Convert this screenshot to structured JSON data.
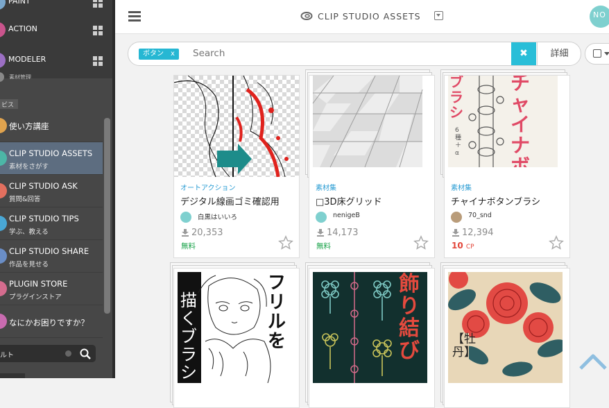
{
  "sidebar": {
    "apps": [
      {
        "label": "PAINT",
        "color": "#7aa7cc"
      },
      {
        "label": "ACTION",
        "color": "#c9548c"
      },
      {
        "label": "MODELER",
        "color": "#9b6fc3"
      }
    ],
    "partial_text": "素材管理",
    "section_label": "ビス",
    "nav": [
      {
        "title": "使い方講座",
        "subtitle": "",
        "color": "#e0a34e"
      },
      {
        "title": "CLIP STUDIO ASSETS",
        "subtitle": "素材をさがす",
        "color": "#4cb6a7",
        "active": true
      },
      {
        "title": "CLIP STUDIO ASK",
        "subtitle": "質問&回答",
        "color": "#e36f5e"
      },
      {
        "title": "CLIP STUDIO TIPS",
        "subtitle": "学ぶ、教える",
        "color": "#49a7d5"
      },
      {
        "title": "CLIP STUDIO SHARE",
        "subtitle": "作品を見せる",
        "color": "#6a8ec7"
      },
      {
        "title": "PLUGIN STORE",
        "subtitle": "プラグインストア",
        "color": "#d46c8e"
      },
      {
        "title": "なにかお困りですか？",
        "subtitle": "",
        "color": "#c96bb0"
      }
    ],
    "search_value": "ルト"
  },
  "header": {
    "brand": "CLIP STUDIO ASSETS",
    "avatar_text": "NO"
  },
  "search": {
    "tag": "ボタン",
    "tag_remove": "x",
    "placeholder": "Search",
    "clear": "✖",
    "detail": "詳細"
  },
  "cards": [
    {
      "category": "オートアクション",
      "title": "デジタル線画ゴミ確認用",
      "author": "白黒はいいろ",
      "downloads": "20,353",
      "price": "無料",
      "price_type": "free"
    },
    {
      "category": "素材集",
      "title": "□3D床グリッド",
      "author": "nenigeB",
      "downloads": "14,173",
      "price": "無料",
      "price_type": "free"
    },
    {
      "category": "素材集",
      "title": "チャイナボタンブラシ",
      "author": "70_snd",
      "downloads": "12,394",
      "price": "10",
      "price_unit": "CP",
      "price_type": "cp"
    }
  ],
  "thumb_text": {
    "china_main": "チャイナボタン",
    "china_left": "ブラシ",
    "china_sub": "6種＋α",
    "frill_1": "フリルを",
    "frill_2": "描くブラシ",
    "knot": "飾り結び",
    "peony": "【牡丹】"
  }
}
